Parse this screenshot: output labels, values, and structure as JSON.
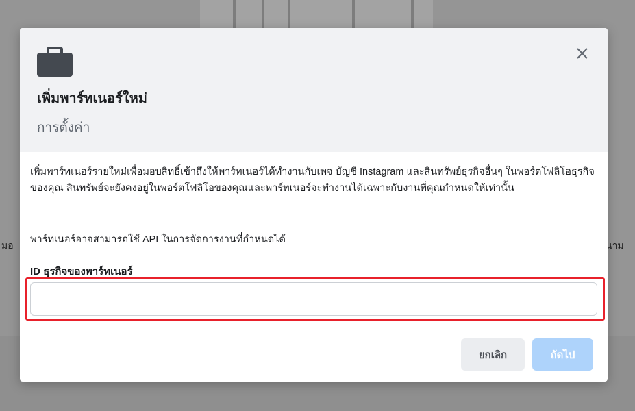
{
  "background": {
    "left_text": "มอ",
    "right_text": "นาม"
  },
  "modal": {
    "icon": "briefcase-icon",
    "close_icon": "close-icon",
    "title": "เพิ่มพาร์ทเนอร์ใหม่",
    "subtitle": "การตั้งค่า",
    "description": "เพิ่มพาร์ทเนอร์รายใหม่เพื่อมอบสิทธิ์เข้าถึงให้พาร์ทเนอร์ได้ทำงานกับเพจ บัญชี Instagram และสินทรัพย์ธุรกิจอื่นๆ ในพอร์ตโฟลิโอธุรกิจของคุณ สินทรัพย์จะยังคงอยู่ในพอร์ตโฟลิโอของคุณและพาร์ทเนอร์จะทำงานได้เฉพาะกับงานที่คุณกำหนดให้เท่านั้น",
    "api_note": "พาร์ทเนอร์อาจสามารถใช้ API ในการจัดการงานที่กำหนดได้",
    "field": {
      "label": "ID ธุรกิจของพาร์ทเนอร์",
      "value": "",
      "placeholder": ""
    },
    "buttons": {
      "cancel": "ยกเลิก",
      "next": "ถัดไป"
    }
  },
  "colors": {
    "highlight": "#e8212b",
    "primary_disabled": "#aed3fb",
    "header_bg": "#f1f2f4"
  }
}
